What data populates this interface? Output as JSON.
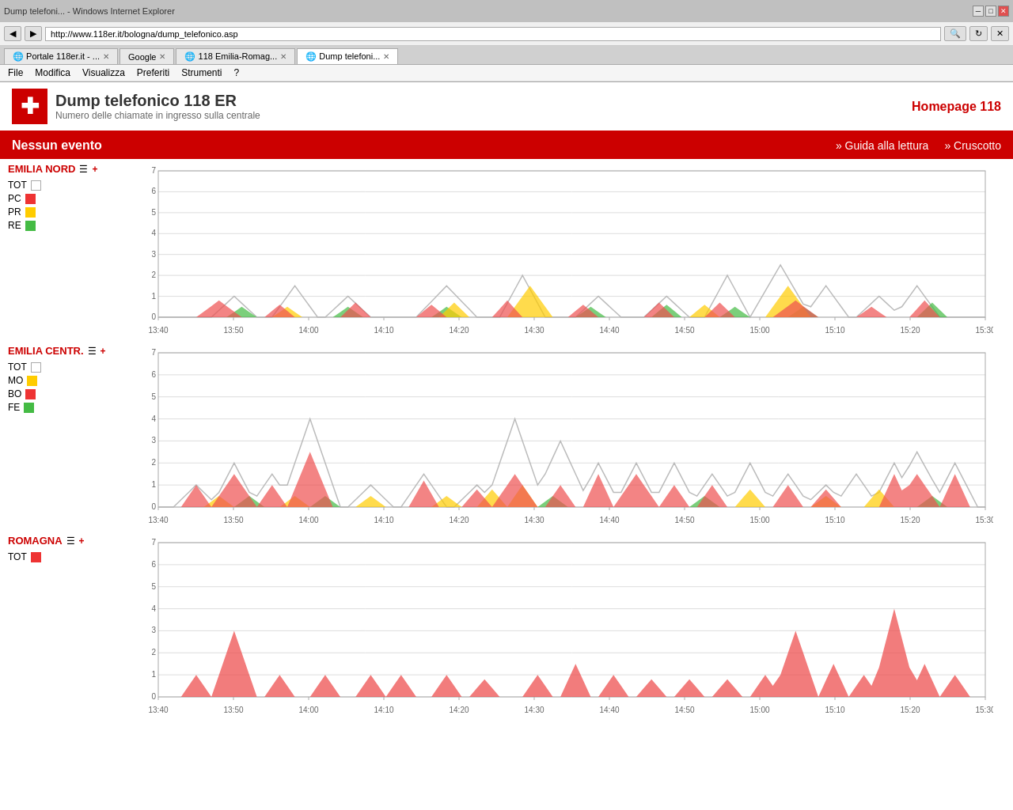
{
  "browser": {
    "url": "http://www.118er.it/bologna/dump_telefonico.asp",
    "tabs": [
      {
        "label": "Portale 118er.it - ...",
        "active": false
      },
      {
        "label": "Google",
        "active": false
      },
      {
        "label": "118 Emilia-Romag...",
        "active": false
      },
      {
        "label": "Dump telefoni...",
        "active": true
      }
    ],
    "menu": [
      "File",
      "Modifica",
      "Visualizza",
      "Preferiti",
      "Strumenti",
      "?"
    ]
  },
  "page": {
    "title": "Dump telefonico 118 ER",
    "subtitle": "Numero delle chiamate in ingresso sulla centrale",
    "homepage_link": "Homepage 118",
    "event_bar": {
      "text": "Nessun evento",
      "links": [
        "» Guida alla lettura",
        "» Cruscotto"
      ]
    }
  },
  "sections": [
    {
      "id": "emilia_nord",
      "title": "EMILIA NORD",
      "legend": [
        {
          "label": "TOT",
          "color": "#ffffff",
          "border": "#aaa"
        },
        {
          "label": "PC",
          "color": "#ee3333"
        },
        {
          "label": "PR",
          "color": "#ffcc00"
        },
        {
          "label": "RE",
          "color": "#44bb44"
        }
      ]
    },
    {
      "id": "emilia_centr",
      "title": "EMILIA CENTR.",
      "legend": [
        {
          "label": "TOT",
          "color": "#ffffff",
          "border": "#aaa"
        },
        {
          "label": "MO",
          "color": "#ffcc00"
        },
        {
          "label": "BO",
          "color": "#ee3333"
        },
        {
          "label": "FE",
          "color": "#44bb44"
        }
      ]
    },
    {
      "id": "romagna",
      "title": "ROMAGNA",
      "legend": [
        {
          "label": "TOT",
          "color": "#ee3333"
        }
      ]
    }
  ],
  "colors": {
    "red": "#cc0000",
    "brand_red": "#cc0000"
  }
}
